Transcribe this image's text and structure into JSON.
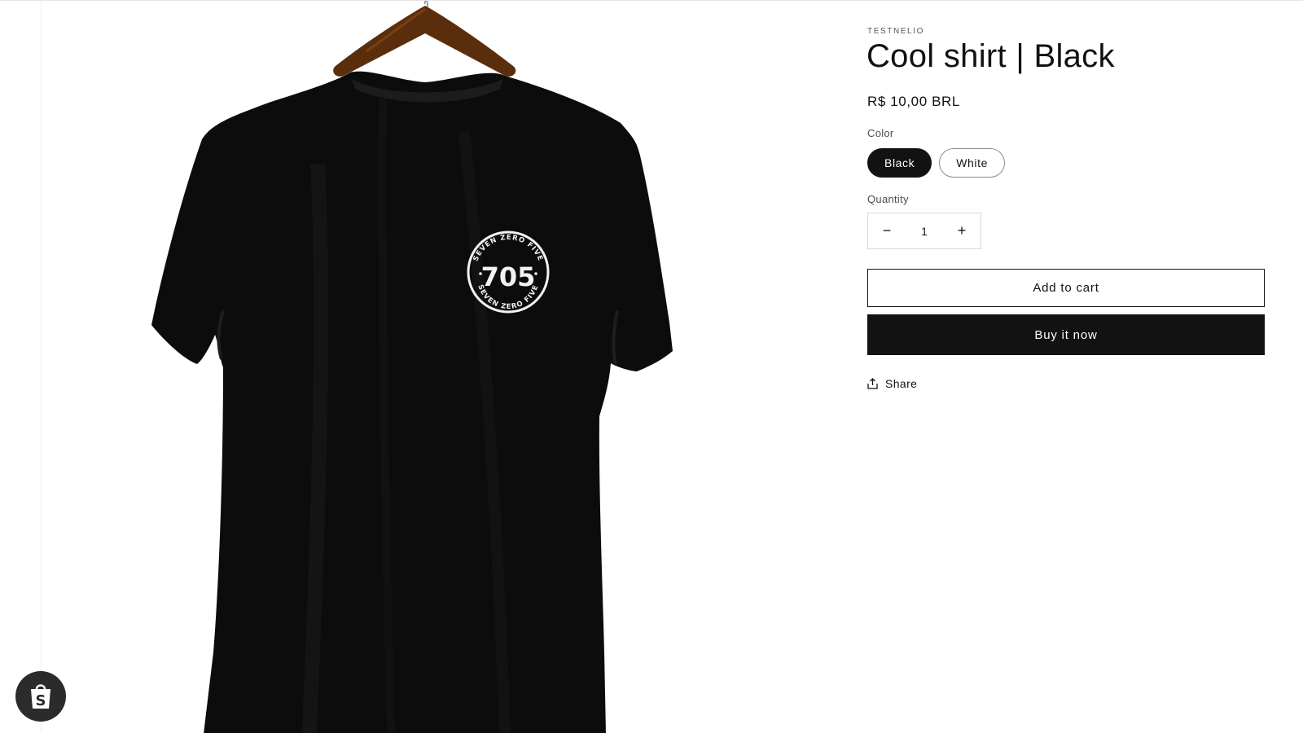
{
  "product": {
    "vendor": "TESTNELIO",
    "title": "Cool shirt | Black",
    "price": "R$ 10,00 BRL",
    "image_alt": "Black t-shirt on wooden hanger with 705 Seven Zero Five circular logo",
    "logo_number": "705",
    "logo_ring_text": "SEVEN ZERO FIVE"
  },
  "options": {
    "color_label": "Color",
    "colors": [
      {
        "label": "Black",
        "selected": true
      },
      {
        "label": "White",
        "selected": false
      }
    ]
  },
  "quantity": {
    "label": "Quantity",
    "value": "1",
    "decrease_symbol": "−",
    "increase_symbol": "+"
  },
  "actions": {
    "add_to_cart": "Add to cart",
    "buy_now": "Buy it now",
    "share": "Share"
  },
  "icons": {
    "share": "share-icon",
    "shop_badge": "shopify-bag-icon"
  },
  "colors": {
    "text": "#121212",
    "button_dark": "#121212",
    "badge_bg": "#2b2b2b"
  }
}
